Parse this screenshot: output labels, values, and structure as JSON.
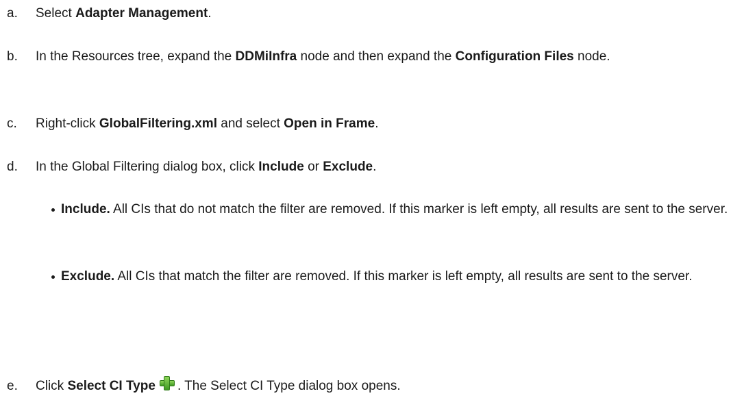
{
  "steps": {
    "a": {
      "marker": "a.",
      "t1": "Select ",
      "b1": "Adapter Management",
      "t2": "."
    },
    "b": {
      "marker": "b.",
      "t1": "In the Resources tree, expand the ",
      "b1": "DDMiInfra",
      "t2": " node and then expand the ",
      "b2": "Configuration Files",
      "t3": " node."
    },
    "c": {
      "marker": "c.",
      "t1": "Right-click ",
      "b1": "GlobalFiltering.xml",
      "t2": " and select ",
      "b2": "Open in Frame",
      "t3": "."
    },
    "d": {
      "marker": "d.",
      "t1": "In the Global Filtering dialog box, click ",
      "b1": "Include",
      "t2": " or ",
      "b2": "Exclude",
      "t3": "."
    },
    "e": {
      "marker": "e.",
      "t1": "Click ",
      "b1": "Select CI Type",
      "icon": "green-plus-icon",
      "t2": ". The Select CI Type dialog box opens."
    }
  },
  "bullets": [
    {
      "bold": "Include.",
      "text": " All CIs that do not match the filter are removed. If this marker is left empty, all results are sent to the server."
    },
    {
      "bold": "Exclude.",
      "text": " All CIs that match the filter are removed. If this marker is left empty, all results are sent to the server."
    }
  ]
}
